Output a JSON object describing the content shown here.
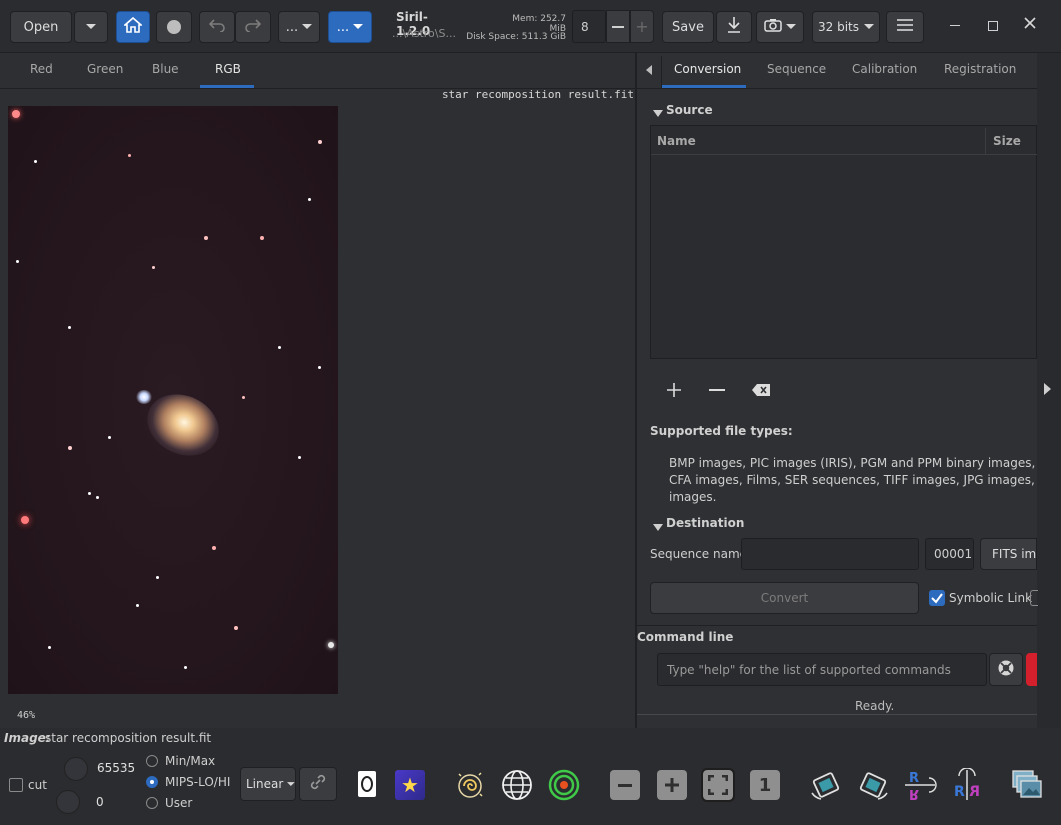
{
  "toolbar": {
    "open_label": "Open",
    "menu_dots_1": "...",
    "menu_dots_2": "...",
    "app_title": "Siril-1.2.0",
    "app_path": "...\\Astro\\S...",
    "mem": "Mem: 252.7 MiB",
    "disk": "Disk Space: 511.3 GiB",
    "thread_count": "8",
    "save_label": "Save",
    "bits_label": "32 bits"
  },
  "left_tabs": [
    "Red",
    "Green",
    "Blue",
    "RGB"
  ],
  "image": {
    "filename_overlay": "star recomposition result.fit",
    "zoom": "46%"
  },
  "right_tabs": [
    "Conversion",
    "Sequence",
    "Calibration",
    "Registration"
  ],
  "conversion": {
    "source_header": "Source",
    "col_name": "Name",
    "col_size": "Size",
    "supported_title": "Supported file types:",
    "supported_text_1": "BMP images, PIC images (IRIS), PGM and PPM binary images, RAW ima",
    "supported_text_2": "CFA images, Films, SER sequences, TIFF images, JPG images, PNG imag",
    "supported_text_3": "images.",
    "destination_header": "Destination",
    "sequence_name_label": "Sequence name:",
    "sequence_name_value": "",
    "start_index": "00001",
    "format": "FITS imag",
    "convert_label": "Convert",
    "symbolic_link_label": "Symbolic Link"
  },
  "command": {
    "header": "Command line",
    "placeholder": "Type \"help\" for the list of supported commands",
    "status": "Ready."
  },
  "status_bar": {
    "image_label": "Image:",
    "image_name": "star recomposition result.fit"
  },
  "bottom": {
    "cut_label": "cut",
    "high_value": "65535",
    "low_value": "0",
    "radio_minmax": "Min/Max",
    "radio_mips": "MIPS-LO/HI",
    "radio_user": "User",
    "stretch": "Linear",
    "zoom_one": "1"
  }
}
